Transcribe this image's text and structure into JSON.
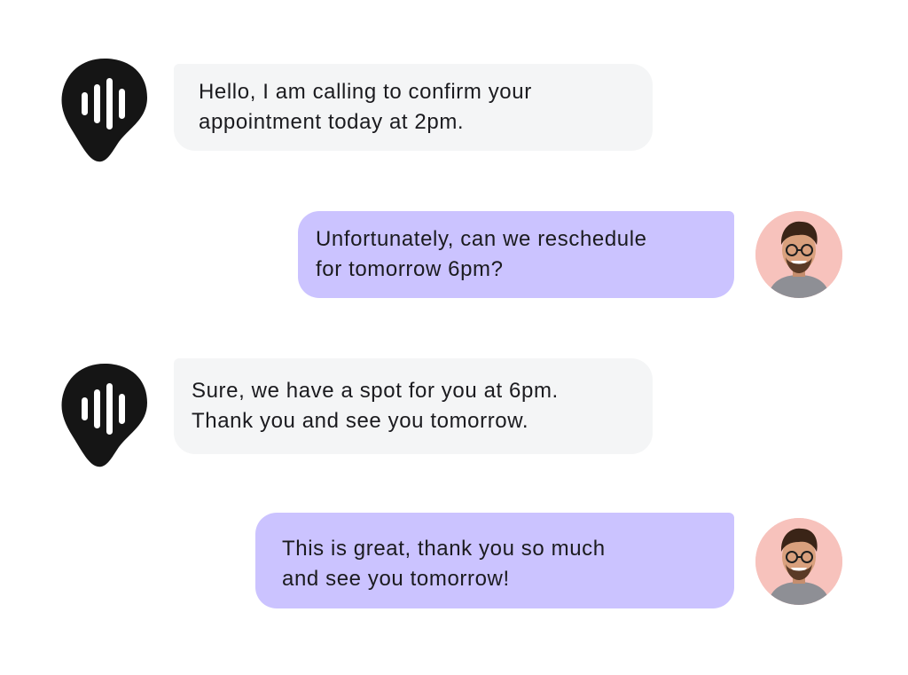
{
  "conversation": {
    "messages": [
      {
        "sender": "bot",
        "icon": "voice-assistant-icon",
        "text": "Hello, I am calling to confirm your\nappointment today at 2pm."
      },
      {
        "sender": "user",
        "icon": "user-avatar",
        "text": "Unfortunately, can we reschedule\nfor tomorrow 6pm?"
      },
      {
        "sender": "bot",
        "icon": "voice-assistant-icon",
        "text": "Sure, we have a spot for you at 6pm.\nThank you and see you tomorrow."
      },
      {
        "sender": "user",
        "icon": "user-avatar",
        "text": "This is great, thank you so much\nand see you tomorrow!"
      }
    ]
  },
  "colors": {
    "bot_bubble": "#f4f5f6",
    "user_bubble": "#cbc3ff",
    "avatar_background": "#f7c2bc",
    "bot_icon": "#151515",
    "text": "#1b1b1f"
  }
}
